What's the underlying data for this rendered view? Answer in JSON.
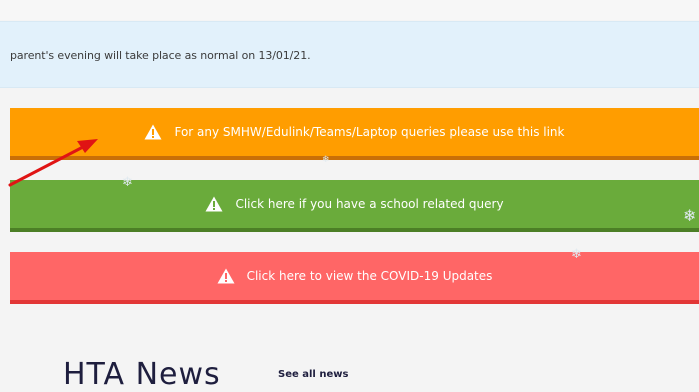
{
  "notice": {
    "text": "parent's evening will take place as normal on 13/01/21."
  },
  "banners": [
    {
      "label": "For any SMHW/Edulink/Teams/Laptop queries please use this link",
      "icon": "warning-icon",
      "color": "#ff9d00"
    },
    {
      "label": "Click here if you have a school related query",
      "icon": "warning-icon",
      "color": "#6aab3b"
    },
    {
      "label": "Click here to view the COVID-19 Updates",
      "icon": "warning-icon",
      "color": "#ff6666"
    }
  ],
  "news": {
    "heading": "HTA News",
    "see_all": "See all news"
  },
  "annotation": {
    "icon": "red-arrow-icon",
    "color": "#e01414"
  }
}
